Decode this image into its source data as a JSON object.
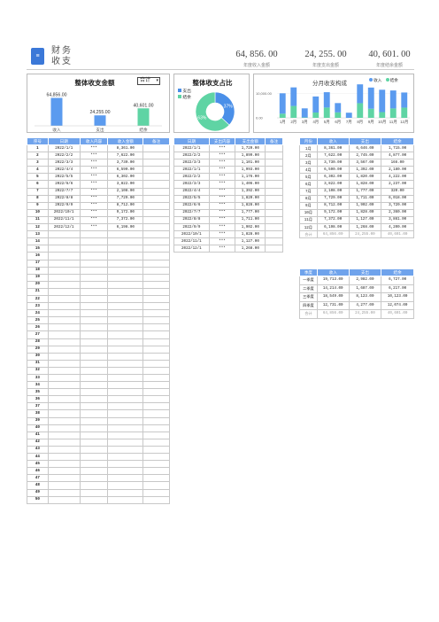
{
  "header": {
    "title": "财务收支",
    "logo_glyph": "≡",
    "stats": [
      {
        "value": "64, 856. 00",
        "label": "年度收入金额"
      },
      {
        "value": "24, 255. 00",
        "label": "年度支出金额"
      },
      {
        "value": "40, 601. 00",
        "label": "年度结余金额"
      }
    ]
  },
  "overall_chart": {
    "title": "整体收支金额",
    "dropdown": "合计",
    "chart_data": {
      "type": "bar",
      "categories": [
        "收入",
        "支出",
        "结余"
      ],
      "values": [
        64856,
        24255,
        40601
      ],
      "value_labels": [
        "64,856.00",
        "24,255.00",
        "40,601.00"
      ],
      "colors": [
        "#5b9bef",
        "#5b9bef",
        "#5fd4a4"
      ]
    }
  },
  "ratio_chart": {
    "title": "整体收支占比",
    "legend": [
      "支出",
      "结余"
    ],
    "chart_data": {
      "type": "pie",
      "categories": [
        "支出",
        "结余"
      ],
      "values": [
        37,
        63
      ],
      "value_labels": [
        "37%",
        "63%"
      ],
      "colors": [
        "#4a8fe8",
        "#5fd4a4"
      ]
    }
  },
  "monthly_chart": {
    "title": "分月收支构成",
    "legend": [
      "收入",
      "结余"
    ],
    "y_ticks": [
      "10,000.00",
      "0.00"
    ],
    "chart_data": {
      "type": "bar",
      "stacked": true,
      "categories": [
        "1月",
        "2月",
        "3月",
        "4月",
        "5月",
        "6月",
        "7月",
        "8月",
        "9月",
        "10月",
        "11月",
        "12月"
      ],
      "series": [
        {
          "name": "收入",
          "values": [
            8361,
            7622,
            3730,
            6590,
            6302,
            3822,
            2108,
            7729,
            8712,
            9172,
            7372,
            6198
          ]
        },
        {
          "name": "结余",
          "values": [
            1715,
            4877,
            166,
            2180,
            4222,
            2237,
            0,
            6018,
            3720,
            2360,
            3861,
            4200
          ]
        }
      ],
      "ylim": [
        0,
        12000
      ],
      "colors": [
        "#5b9bef",
        "#5fd4a4"
      ]
    }
  },
  "income_table": {
    "headers": [
      "序号",
      "日期",
      "收入内容",
      "收入金额",
      "备注"
    ],
    "rows": [
      [
        "1",
        "2022/1/1",
        "***",
        "8,361.00",
        ""
      ],
      [
        "2",
        "2022/2/2",
        "***",
        "7,622.00",
        ""
      ],
      [
        "3",
        "2022/3/3",
        "***",
        "3,730.00",
        ""
      ],
      [
        "4",
        "2022/4/4",
        "***",
        "6,590.00",
        ""
      ],
      [
        "5",
        "2022/5/5",
        "***",
        "6,302.00",
        ""
      ],
      [
        "6",
        "2022/6/6",
        "***",
        "3,822.00",
        ""
      ],
      [
        "7",
        "2022/7/7",
        "***",
        "2,108.00",
        ""
      ],
      [
        "8",
        "2022/8/8",
        "***",
        "7,729.00",
        ""
      ],
      [
        "9",
        "2022/9/9",
        "***",
        "8,712.00",
        ""
      ],
      [
        "10",
        "2022/10/1",
        "***",
        "9,172.00",
        ""
      ],
      [
        "11",
        "2022/11/1",
        "***",
        "7,372.00",
        ""
      ],
      [
        "12",
        "2022/12/1",
        "***",
        "6,198.00",
        ""
      ],
      [
        "13",
        "",
        "",
        "",
        ""
      ],
      [
        "14",
        "",
        "",
        "",
        ""
      ],
      [
        "15",
        "",
        "",
        "",
        ""
      ],
      [
        "16",
        "",
        "",
        "",
        ""
      ],
      [
        "17",
        "",
        "",
        "",
        ""
      ],
      [
        "18",
        "",
        "",
        "",
        ""
      ],
      [
        "19",
        "",
        "",
        "",
        ""
      ],
      [
        "20",
        "",
        "",
        "",
        ""
      ],
      [
        "21",
        "",
        "",
        "",
        ""
      ],
      [
        "22",
        "",
        "",
        "",
        ""
      ],
      [
        "23",
        "",
        "",
        "",
        ""
      ],
      [
        "24",
        "",
        "",
        "",
        ""
      ],
      [
        "25",
        "",
        "",
        "",
        ""
      ],
      [
        "26",
        "",
        "",
        "",
        ""
      ],
      [
        "27",
        "",
        "",
        "",
        ""
      ],
      [
        "28",
        "",
        "",
        "",
        ""
      ],
      [
        "29",
        "",
        "",
        "",
        ""
      ],
      [
        "30",
        "",
        "",
        "",
        ""
      ],
      [
        "31",
        "",
        "",
        "",
        ""
      ],
      [
        "32",
        "",
        "",
        "",
        ""
      ],
      [
        "33",
        "",
        "",
        "",
        ""
      ],
      [
        "34",
        "",
        "",
        "",
        ""
      ],
      [
        "35",
        "",
        "",
        "",
        ""
      ],
      [
        "36",
        "",
        "",
        "",
        ""
      ],
      [
        "37",
        "",
        "",
        "",
        ""
      ],
      [
        "38",
        "",
        "",
        "",
        ""
      ],
      [
        "39",
        "",
        "",
        "",
        ""
      ],
      [
        "40",
        "",
        "",
        "",
        ""
      ],
      [
        "41",
        "",
        "",
        "",
        ""
      ],
      [
        "42",
        "",
        "",
        "",
        ""
      ],
      [
        "43",
        "",
        "",
        "",
        ""
      ],
      [
        "44",
        "",
        "",
        "",
        ""
      ],
      [
        "45",
        "",
        "",
        "",
        ""
      ],
      [
        "46",
        "",
        "",
        "",
        ""
      ],
      [
        "47",
        "",
        "",
        "",
        ""
      ],
      [
        "48",
        "",
        "",
        "",
        ""
      ],
      [
        "49",
        "",
        "",
        "",
        ""
      ],
      [
        "50",
        "",
        "",
        "",
        ""
      ]
    ]
  },
  "expense_table": {
    "headers": [
      "日期",
      "支出内容",
      "支出金额",
      "备注"
    ],
    "rows": [
      [
        "2022/1/1",
        "***",
        "1,720.00",
        ""
      ],
      [
        "2022/2/2",
        "***",
        "1,899.00",
        ""
      ],
      [
        "2022/3/3",
        "***",
        "1,101.00",
        ""
      ],
      [
        "2022/1/1",
        "***",
        "1,993.00",
        ""
      ],
      [
        "2022/2/2",
        "***",
        "1,176.00",
        ""
      ],
      [
        "2022/3/3",
        "***",
        "1,406.00",
        ""
      ],
      [
        "2022/4/4",
        "***",
        "1,392.00",
        ""
      ],
      [
        "2022/5/5",
        "***",
        "1,820.00",
        ""
      ],
      [
        "2022/6/6",
        "***",
        "1,828.00",
        ""
      ],
      [
        "2022/7/7",
        "***",
        "1,777.00",
        ""
      ],
      [
        "2022/8/8",
        "***",
        "1,711.00",
        ""
      ],
      [
        "2022/9/9",
        "***",
        "1,902.00",
        ""
      ],
      [
        "2022/10/1",
        "***",
        "1,828.00",
        ""
      ],
      [
        "2022/11/1",
        "***",
        "1,127.00",
        ""
      ],
      [
        "2022/12/1",
        "***",
        "1,268.00",
        ""
      ]
    ]
  },
  "month_table": {
    "headers": [
      "月份",
      "收入",
      "支出",
      "结余"
    ],
    "rows": [
      [
        "1月",
        "8,361.00",
        "6,646.00",
        "1,715.00"
      ],
      [
        "2月",
        "7,622.00",
        "2,745.00",
        "4,877.00"
      ],
      [
        "3月",
        "3,730.00",
        "3,567.00",
        "166.00"
      ],
      [
        "4月",
        "6,590.00",
        "1,392.00",
        "2,180.00"
      ],
      [
        "5月",
        "6,302.00",
        "1,820.00",
        "4,222.00"
      ],
      [
        "6月",
        "3,822.00",
        "1,828.00",
        "2,237.00"
      ],
      [
        "7月",
        "2,108.00",
        "1,777.00",
        "320.00"
      ],
      [
        "8月",
        "7,729.00",
        "1,711.00",
        "6,018.00"
      ],
      [
        "9月",
        "8,712.00",
        "1,902.00",
        "3,720.00"
      ],
      [
        "10月",
        "9,172.00",
        "1,828.00",
        "2,360.00"
      ],
      [
        "11月",
        "7,372.00",
        "1,127.00",
        "3,861.00"
      ],
      [
        "12月",
        "6,198.00",
        "1,268.00",
        "4,200.00"
      ],
      [
        "合计",
        "64,856.00",
        "24,255.00",
        "40,601.00"
      ]
    ]
  },
  "quarter_table": {
    "headers": [
      "季度",
      "收入",
      "支出",
      "结余"
    ],
    "rows": [
      [
        "一季度",
        "19,713.00",
        "2,982.00",
        "6,727.00"
      ],
      [
        "二季度",
        "14,214.00",
        "1,687.00",
        "6,217.00"
      ],
      [
        "三季度",
        "18,549.00",
        "8,123.00",
        "10,123.00"
      ],
      [
        "四季度",
        "12,731.00",
        "4,277.00",
        "12,074.00"
      ],
      [
        "合计",
        "64,856.00",
        "24,255.00",
        "40,601.00"
      ]
    ]
  }
}
